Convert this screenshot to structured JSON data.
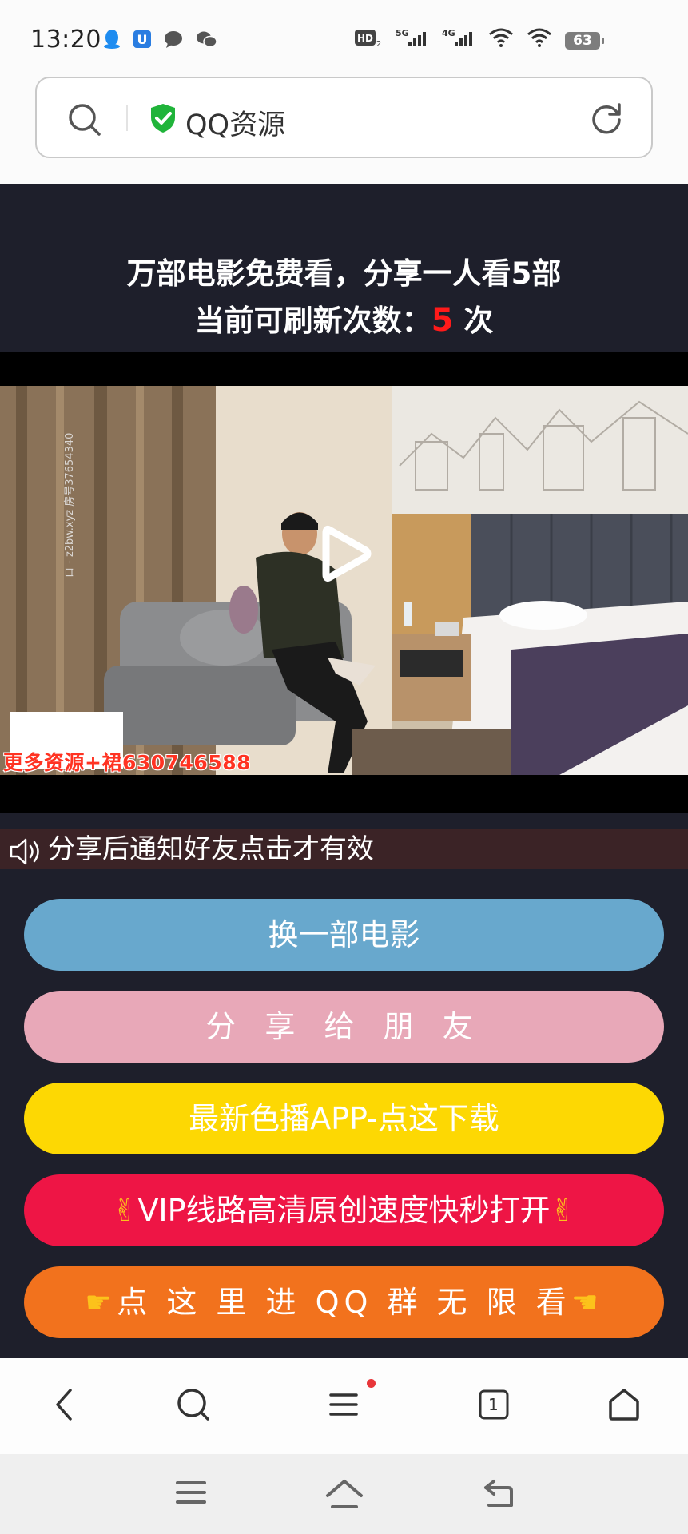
{
  "status_bar": {
    "time": "13:20",
    "battery": "63",
    "left_icons": [
      "qq-icon",
      "app-icon",
      "message-icon",
      "wechat-icon"
    ],
    "right_icons": [
      "hd-icon",
      "5g-signal-icon",
      "4g-signal-icon",
      "wifi-icon",
      "wifi-icon"
    ]
  },
  "url_bar": {
    "title": "QQ资源"
  },
  "headline": {
    "line1": "万部电影免费看，分享一人看5部",
    "line2_prefix": "当前可刷新次数：",
    "refresh_count": "5",
    "line2_suffix": " 次"
  },
  "video": {
    "watermark": "更多资源+裙630746588",
    "side_text": "ロ - z2bw.xyz 房号37654340"
  },
  "notice": {
    "text": "分享后通知好友点击才有效"
  },
  "buttons": {
    "change_movie": "换一部电影",
    "share": "分 享 给 朋 友",
    "download_app": "最新色播APP-点这下载",
    "vip_line": "VIP线路高清原创速度快秒打开",
    "qq_group": "点 这 里 进 QQ 群 无 限 看"
  },
  "colors": {
    "main_bg": "#1e1f2b",
    "btn_change": "#68a8cd",
    "btn_share": "#e8a8b8",
    "btn_download": "#fdd803",
    "btn_vip": "#ee1545",
    "btn_qq": "#f2721d",
    "count_red": "#ff1a1a"
  },
  "toolbar": {
    "tabs_count": "1"
  }
}
